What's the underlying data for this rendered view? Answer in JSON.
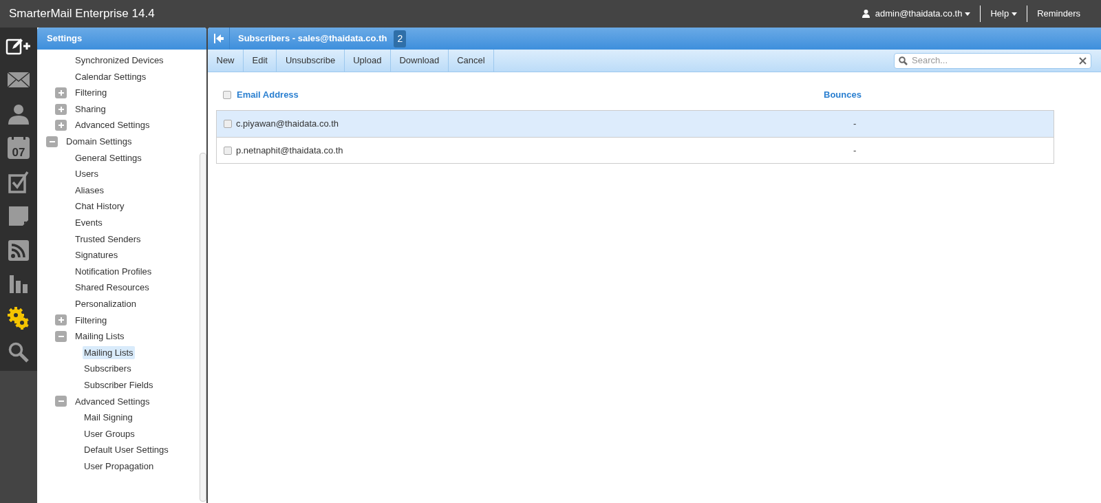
{
  "app_title": "SmarterMail Enterprise 14.4",
  "top_menu": [
    {
      "kind": "user",
      "label": "admin@thaidata.co.th",
      "dropdown": true
    },
    {
      "kind": "plain",
      "label": "Help",
      "dropdown": true
    },
    {
      "kind": "plain",
      "label": "Reminders",
      "dropdown": false
    }
  ],
  "nav": [
    {
      "kind": "compose",
      "selected": false
    },
    {
      "kind": "mail",
      "selected": false
    },
    {
      "kind": "contacts",
      "selected": false
    },
    {
      "kind": "calendar",
      "label": "07",
      "selected": false
    },
    {
      "kind": "tasks",
      "selected": false
    },
    {
      "kind": "notes",
      "selected": false
    },
    {
      "kind": "rss",
      "selected": false
    },
    {
      "kind": "reports",
      "selected": false
    },
    {
      "kind": "settings",
      "selected": true
    },
    {
      "kind": "search",
      "selected": false
    }
  ],
  "settings_panel": {
    "title": "Settings",
    "tree": [
      {
        "children": [
          {
            "label": "Synchronized Devices",
            "selected": false
          },
          {
            "label": "Calendar Settings",
            "selected": false
          },
          {
            "label": "Filtering",
            "expanded": false,
            "selected": false
          },
          {
            "label": "Sharing",
            "expanded": false,
            "selected": false
          },
          {
            "label": "Advanced Settings",
            "expanded": false,
            "selected": false
          }
        ]
      },
      {
        "label": "Domain Settings",
        "expanded": true,
        "selected": false,
        "children": [
          {
            "label": "General Settings",
            "selected": false
          },
          {
            "label": "Users",
            "selected": false
          },
          {
            "label": "Aliases",
            "selected": false
          },
          {
            "label": "Chat History",
            "selected": false
          },
          {
            "label": "Events",
            "selected": false
          },
          {
            "label": "Trusted Senders",
            "selected": false
          },
          {
            "label": "Signatures",
            "selected": false
          },
          {
            "label": "Notification Profiles",
            "selected": false
          },
          {
            "label": "Shared Resources",
            "selected": false
          },
          {
            "label": "Personalization",
            "selected": false
          },
          {
            "label": "Filtering",
            "expanded": false,
            "selected": false
          },
          {
            "label": "Mailing Lists",
            "expanded": true,
            "selected": false,
            "children": [
              {
                "label": "Mailing Lists",
                "selected": true
              },
              {
                "label": "Subscribers",
                "selected": false
              },
              {
                "label": "Subscriber Fields",
                "selected": false
              }
            ]
          },
          {
            "label": "Advanced Settings",
            "expanded": true,
            "selected": false,
            "children": [
              {
                "label": "Mail Signing",
                "selected": false
              },
              {
                "label": "User Groups",
                "selected": false
              },
              {
                "label": "Default User Settings",
                "selected": false
              },
              {
                "label": "User Propagation",
                "selected": false
              }
            ]
          }
        ]
      }
    ]
  },
  "content": {
    "title": "Subscribers - sales@thaidata.co.th",
    "count": "2",
    "toolbar": [
      "New",
      "Edit",
      "Unsubscribe",
      "Upload",
      "Download",
      "Cancel"
    ],
    "search": {
      "placeholder": "Search..."
    },
    "table": {
      "columns": [
        {
          "label": "Email Address"
        },
        {
          "label": "Bounces"
        }
      ],
      "select_all": false,
      "rows": [
        {
          "email": "c.piyawan@thaidata.co.th",
          "bounces": "-",
          "selected": true,
          "checked": false
        },
        {
          "email": "p.netnaphit@thaidata.co.th",
          "bounces": "-",
          "selected": false,
          "checked": false
        }
      ]
    }
  }
}
